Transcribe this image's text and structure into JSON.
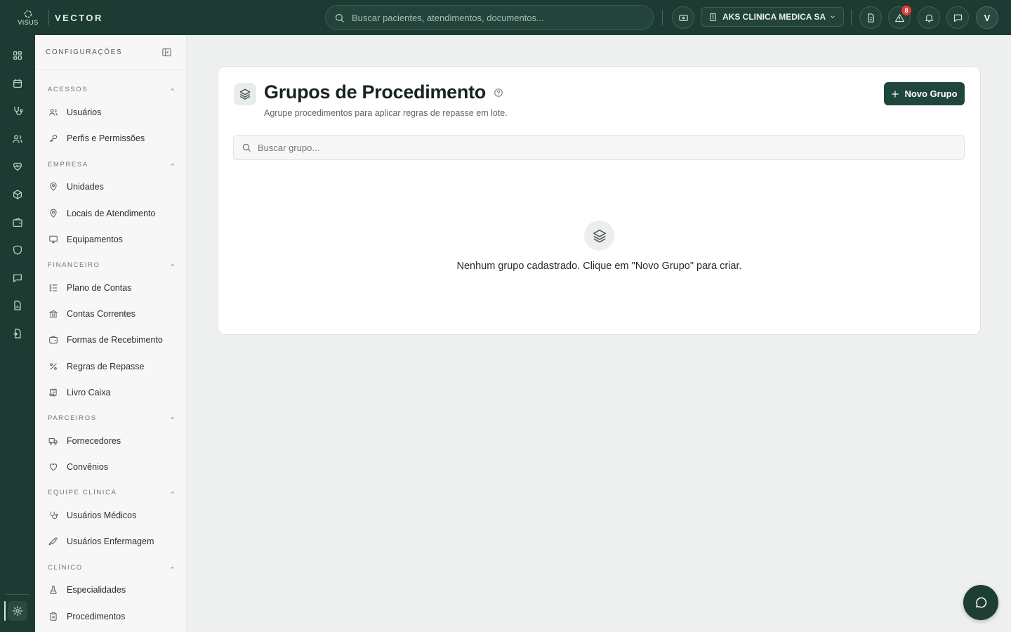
{
  "app": {
    "brand": "VISUS",
    "product": "VECTOR"
  },
  "topbar": {
    "search_placeholder": "Buscar pacientes, atendimentos, documentos...",
    "clinic_name": "AKS CLINICA MEDICA SA",
    "alerts_count": "8",
    "avatar_initial": "V"
  },
  "sidebar": {
    "title": "CONFIGURAÇÕES",
    "sections": [
      {
        "label": "ACESSOS",
        "items": [
          {
            "label": "Usuários",
            "icon": "users-icon"
          },
          {
            "label": "Perfis e Permissões",
            "icon": "key-icon"
          }
        ]
      },
      {
        "label": "EMPRESA",
        "items": [
          {
            "label": "Unidades",
            "icon": "map-pin-icon"
          },
          {
            "label": "Locais de Atendimento",
            "icon": "map-pin-icon"
          },
          {
            "label": "Equipamentos",
            "icon": "monitor-icon"
          }
        ]
      },
      {
        "label": "FINANCEIRO",
        "items": [
          {
            "label": "Plano de Contas",
            "icon": "list-tree-icon"
          },
          {
            "label": "Contas Correntes",
            "icon": "bank-icon"
          },
          {
            "label": "Formas de Recebimento",
            "icon": "wallet-icon"
          },
          {
            "label": "Regras de Repasse",
            "icon": "percent-icon"
          },
          {
            "label": "Livro Caixa",
            "icon": "scroll-icon"
          }
        ]
      },
      {
        "label": "PARCEIROS",
        "items": [
          {
            "label": "Fornecedores",
            "icon": "truck-icon"
          },
          {
            "label": "Convênios",
            "icon": "heart-icon"
          }
        ]
      },
      {
        "label": "EQUIPE CLÍNICA",
        "items": [
          {
            "label": "Usuários Médicos",
            "icon": "stethoscope-icon"
          },
          {
            "label": "Usuários Enfermagem",
            "icon": "syringe-icon"
          }
        ]
      },
      {
        "label": "CLÍNICO",
        "items": [
          {
            "label": "Especialidades",
            "icon": "flask-icon"
          },
          {
            "label": "Procedimentos",
            "icon": "clipboard-icon"
          }
        ]
      }
    ]
  },
  "main": {
    "title": "Grupos de Procedimento",
    "subtitle": "Agrupe procedimentos para aplicar regras de repasse em lote.",
    "new_button": "Novo Grupo",
    "search_placeholder": "Buscar grupo...",
    "empty_message": "Nenhum grupo cadastrado. Clique em \"Novo Grupo\" para criar."
  },
  "colors": {
    "primary": "#1d3b33",
    "button": "#1f463c",
    "badge": "#e53935",
    "background": "#eef0ef"
  }
}
